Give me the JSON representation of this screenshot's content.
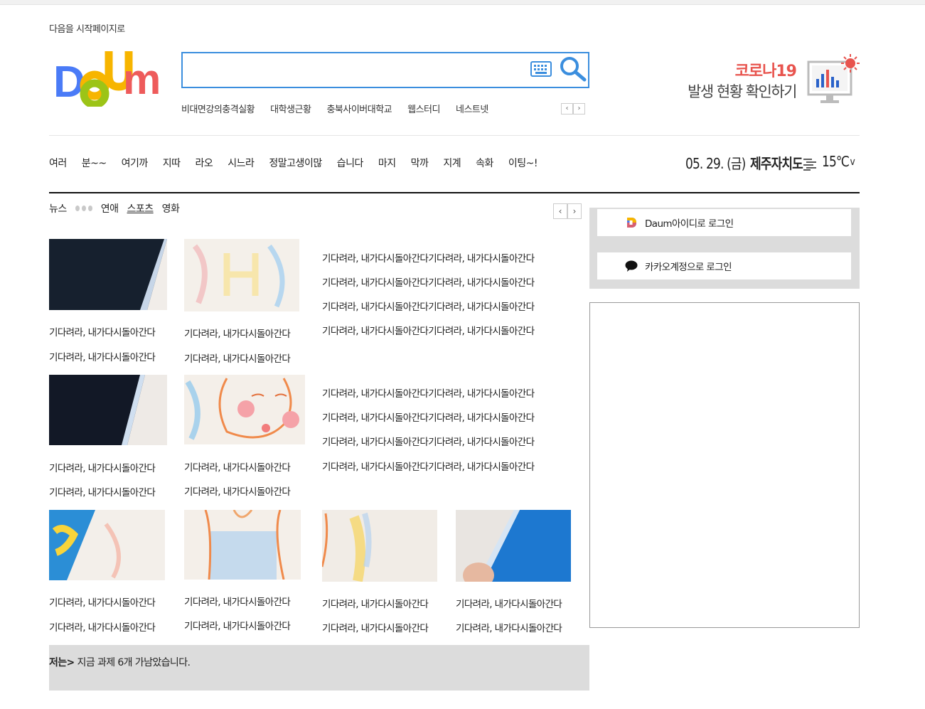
{
  "header": {
    "start_page_link": "다음을 시작페이지로",
    "logo_text": "Daum",
    "search": {
      "value": "",
      "placeholder": ""
    },
    "keywords": [
      "비대면강의충격실황",
      "대학생근황",
      "충북사이버대학교",
      "웹스터디",
      "네스트넷"
    ],
    "keyword_prev": "‹",
    "keyword_next": "›"
  },
  "corona_banner": {
    "title": "코로나19",
    "subtitle": "발생 현황 확인하기"
  },
  "nav": {
    "items": [
      "여러",
      "분~~",
      "여기까",
      "지따",
      "라오",
      "시느라",
      "정말고생이많",
      "습니다",
      "마지",
      "막까",
      "지계",
      "속화",
      "이팅~!"
    ]
  },
  "weather": {
    "date": "05. 29. (금)",
    "region": "제주자치도",
    "temperature": "15℃",
    "dropdown": "∨",
    "icon": "haze-icon"
  },
  "news": {
    "tabs": [
      "뉴스",
      "연애",
      "스포츠",
      "영화"
    ],
    "prev": "‹",
    "next": "›",
    "grid_rows": [
      {
        "captions": [
          [
            "기다려라, 내가다시돌아간다",
            "기다려라, 내가다시돌아간다"
          ],
          [
            "기다려라, 내가다시돌아간다",
            "기다려라, 내가다시돌아간다"
          ]
        ],
        "right_lines": [
          "기다려라, 내가다시돌아간다기다려라, 내가다시돌아간다",
          "기다려라, 내가다시돌아간다기다려라, 내가다시돌아간다",
          "기다려라, 내가다시돌아간다기다려라, 내가다시돌아간다",
          "기다려라, 내가다시돌아간다기다려라, 내가다시돌아간다"
        ]
      },
      {
        "captions": [
          [
            "기다려라, 내가다시돌아간다",
            "기다려라, 내가다시돌아간다"
          ],
          [
            "기다려라, 내가다시돌아간다",
            "기다려라, 내가다시돌아간다"
          ]
        ],
        "right_lines": [
          "기다려라, 내가다시돌아간다기다려라, 내가다시돌아간다",
          "기다려라, 내가다시돌아간다기다려라, 내가다시돌아간다",
          "기다려라, 내가다시돌아간다기다려라, 내가다시돌아간다",
          "기다려라, 내가다시돌아간다기다려라, 내가다시돌아간다"
        ]
      }
    ],
    "bottom_row_captions": [
      [
        "기다려라, 내가다시돌아간다",
        "기다려라, 내가다시돌아간다"
      ],
      [
        "기다려라, 내가다시돌아간다",
        "기다려라, 내가다시돌아간다"
      ],
      [
        "기다려라, 내가다시돌아간다",
        "기다려라, 내가다시돌아간다"
      ],
      [
        "기다려라, 내가다시돌아간다",
        "기다려라, 내가다시돌아간다"
      ]
    ]
  },
  "footer": {
    "label": "저는>",
    "text": " 지금 과제 6개 가남았습니다."
  },
  "login": {
    "daum_login": "Daum아이디로 로그인",
    "kakao_login": "카카오계정으로 로그인"
  },
  "colors": {
    "search_border": "#3b8ede",
    "corona_red": "#e8544e",
    "panel_gray": "#dcdcdc"
  }
}
